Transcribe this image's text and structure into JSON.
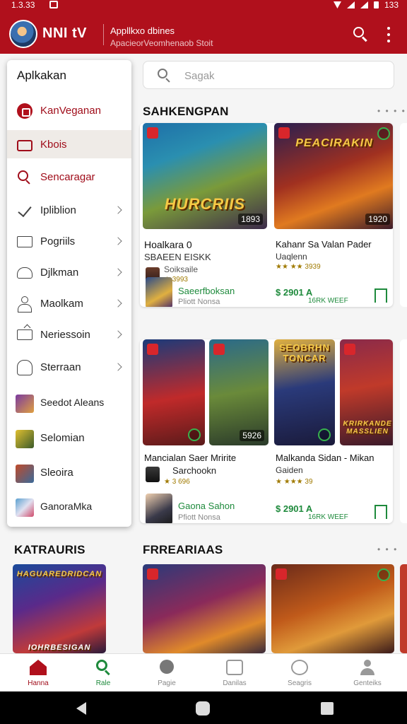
{
  "status_bar": {
    "time": "1.3.33",
    "right_text": "133"
  },
  "app_bar": {
    "brand": "NNI tV",
    "title": "Appllkxo dbines",
    "subtitle": "ApacieorVeomhenaob Stoit"
  },
  "search": {
    "placeholder": "Sagak"
  },
  "drawer": {
    "title": "Aplkakan",
    "items": [
      {
        "label": "KanVeganan"
      },
      {
        "label": "Kbois"
      },
      {
        "label": "Sencaragar"
      },
      {
        "label": "Ipliblion"
      },
      {
        "label": "Pogriils"
      },
      {
        "label": "Djlkman"
      },
      {
        "label": "Maolkam"
      },
      {
        "label": "Neriessoin"
      },
      {
        "label": "Sterraan"
      },
      {
        "label": "Seedot Aleans"
      },
      {
        "label": "Selomian"
      },
      {
        "label": "Sleoira"
      },
      {
        "label": "GanoraMka"
      }
    ]
  },
  "section1": {
    "title": "SAHKENGPAN",
    "more": "• • • •",
    "card1": {
      "game1": {
        "art_title": "HURCRIIS",
        "art_number": "1893",
        "name": "Hoalkara 0",
        "sub": "SBAEEN EISKK",
        "dev": "Soiksaile",
        "rating": "★ 3993"
      },
      "game2": {
        "art_title": "PEACIRAKIN",
        "art_number": "1920",
        "name": "Kahanr Sa Valan Pader",
        "sub": "Uaqlenn",
        "rating": "★★ ★★ 3939"
      },
      "footer": {
        "link": "Saeerfboksan",
        "note": "Pliott Nonsa",
        "price": "$ 2901 A",
        "price_note": "16RK WEEF"
      }
    },
    "card2": {
      "game1": {
        "art_number": "5926",
        "name": "Mancialan Saer Mririte",
        "sub": "Sarchookn",
        "rating": "★ 3 696"
      },
      "game2": {
        "art_title": "SEOBRHN TONCAR",
        "art_title2": "KRIRKANDE MASSLIEN",
        "name": "Malkanda Sidan - Mikan",
        "sub": "Gaiden",
        "rating": "★ ★★★ 39"
      },
      "footer": {
        "link": "Gaona Sahon",
        "note": "Pfiott Nonsa",
        "price": "$ 2901 A",
        "price_note": "16RK WEEF"
      }
    }
  },
  "section2": {
    "left_title": "KATRAURIS",
    "title": "FRREARIAAS",
    "more": "• • •",
    "tile1_title": "HAGUAREDRIDCAN",
    "tile1_sub": "IOHRBESIGAN"
  },
  "bottom_nav": {
    "items": [
      {
        "label": "Hanna"
      },
      {
        "label": "Rale"
      },
      {
        "label": "Pagie"
      },
      {
        "label": "Danilas"
      },
      {
        "label": "Seagris"
      },
      {
        "label": "Genteiks"
      }
    ]
  },
  "colors": {
    "brand_red": "#b0101c",
    "green": "#1e8a3c",
    "rating": "#e8a100"
  }
}
